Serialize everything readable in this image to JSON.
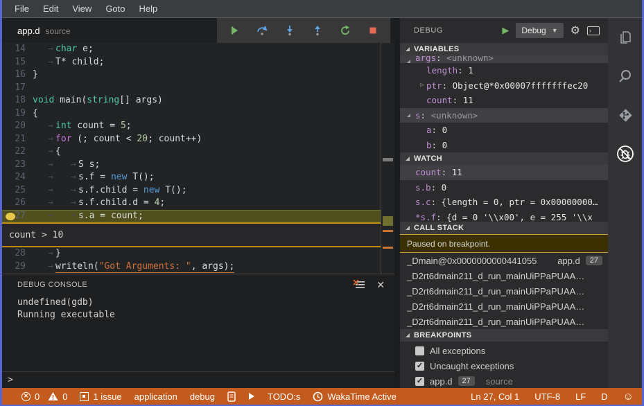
{
  "menu": {
    "items": [
      "File",
      "Edit",
      "View",
      "Goto",
      "Help"
    ]
  },
  "tab": {
    "name": "app.d",
    "hint": "source"
  },
  "debug_toolbar": {
    "buttons": [
      "continue",
      "step-over",
      "step-into",
      "step-out",
      "restart",
      "stop"
    ]
  },
  "editor": {
    "current_line": 27,
    "breakpoint_line": 27,
    "peek_after": 27,
    "peek_text": "count > 10",
    "lines": [
      {
        "n": 14,
        "tabs": 1,
        "tokens": [
          [
            "t",
            "char"
          ],
          [
            "p",
            " e;"
          ]
        ]
      },
      {
        "n": 15,
        "tabs": 1,
        "tokens": [
          [
            "p",
            "T* child;"
          ]
        ]
      },
      {
        "n": 16,
        "tabs": 0,
        "tokens": [
          [
            "p",
            "}"
          ]
        ]
      },
      {
        "n": 17,
        "tabs": 0,
        "tokens": []
      },
      {
        "n": 18,
        "tabs": 0,
        "tokens": [
          [
            "t",
            "void"
          ],
          [
            "p",
            " main("
          ],
          [
            "t",
            "string"
          ],
          [
            "p",
            "[] args)"
          ]
        ]
      },
      {
        "n": 19,
        "tabs": 0,
        "tokens": [
          [
            "p",
            "{"
          ]
        ]
      },
      {
        "n": 20,
        "tabs": 1,
        "tokens": [
          [
            "t",
            "int"
          ],
          [
            "p",
            " count = "
          ],
          [
            "n",
            "5"
          ],
          [
            "p",
            ";"
          ]
        ]
      },
      {
        "n": 21,
        "tabs": 1,
        "tokens": [
          [
            "k",
            "for"
          ],
          [
            "p",
            " (; count < "
          ],
          [
            "n",
            "20"
          ],
          [
            "p",
            "; count++)"
          ]
        ]
      },
      {
        "n": 22,
        "tabs": 1,
        "tokens": [
          [
            "p",
            "{"
          ]
        ]
      },
      {
        "n": 23,
        "tabs": 2,
        "tokens": [
          [
            "p",
            "S s;"
          ]
        ]
      },
      {
        "n": 24,
        "tabs": 2,
        "tokens": [
          [
            "p",
            "s.f = "
          ],
          [
            "b",
            "new"
          ],
          [
            "p",
            " T();"
          ]
        ]
      },
      {
        "n": 25,
        "tabs": 2,
        "tokens": [
          [
            "p",
            "s.f.child = "
          ],
          [
            "b",
            "new"
          ],
          [
            "p",
            " T();"
          ]
        ]
      },
      {
        "n": 26,
        "tabs": 2,
        "tokens": [
          [
            "p",
            "s.f.child.d = "
          ],
          [
            "n",
            "4"
          ],
          [
            "p",
            ";"
          ]
        ]
      },
      {
        "n": 27,
        "tabs": 2,
        "tokens": [
          [
            "p",
            "s.a = count;"
          ]
        ]
      },
      {
        "n": 28,
        "tabs": 1,
        "tokens": [
          [
            "p",
            "}"
          ]
        ]
      },
      {
        "n": 29,
        "tabs": 1,
        "u": true,
        "tokens": [
          [
            "p",
            "writeln("
          ],
          [
            "s",
            "\"Got Arguments: \""
          ],
          [
            "p",
            ", args);"
          ]
        ]
      }
    ]
  },
  "console": {
    "title": "DEBUG CONSOLE",
    "lines": [
      "undefined(gdb)",
      "Running executable"
    ],
    "prompt": ">"
  },
  "side_panel": {
    "title": "DEBUG",
    "config": "Debug",
    "variables": {
      "title": "VARIABLES",
      "rows": [
        {
          "indent": 1,
          "exp": "down",
          "name": "args",
          "value": "<unknown>",
          "sel": true,
          "clip": "top"
        },
        {
          "indent": 2,
          "name": "length",
          "value": "1"
        },
        {
          "indent": 2,
          "exp": "right",
          "name": "ptr",
          "value": "Object@*0x00007fffffffec20"
        },
        {
          "indent": 2,
          "name": "count",
          "value": "11"
        },
        {
          "indent": 1,
          "exp": "down",
          "name": "s",
          "value": "<unknown>",
          "sel": true
        },
        {
          "indent": 2,
          "name": "a",
          "value": "0"
        },
        {
          "indent": 2,
          "name": "b",
          "value": "0"
        }
      ]
    },
    "watch": {
      "title": "WATCH",
      "rows": [
        {
          "indent": 1,
          "name": "count",
          "value": "11",
          "sel": true
        },
        {
          "indent": 1,
          "name": "s.b",
          "value": "0"
        },
        {
          "indent": 1,
          "name": "s.c",
          "value": "{length = 0, ptr = 0x00000000…"
        },
        {
          "indent": 1,
          "name": "*s.f",
          "value": "{d = 0 '\\\\x00', e = 255 '\\\\x",
          "clip": "bottom"
        }
      ]
    },
    "call_stack": {
      "title": "CALL STACK",
      "status": "Paused on breakpoint.",
      "frames": [
        {
          "label": "_Dmain@0x0000000000441055",
          "file": "app.d",
          "line": "27"
        },
        {
          "label": "_D2rt6dmain211_d_run_mainUiPPaPUAA…"
        },
        {
          "label": "_D2rt6dmain211_d_run_mainUiPPaPUAA…"
        },
        {
          "label": "_D2rt6dmain211_d_run_mainUiPPaPUAA…"
        },
        {
          "label": "_D2rt6dmain211_d_run_mainUiPPaPUAA…"
        }
      ]
    },
    "breakpoints": {
      "title": "BREAKPOINTS",
      "items": [
        {
          "label": "All exceptions",
          "checked": false
        },
        {
          "label": "Uncaught exceptions",
          "checked": true
        },
        {
          "label": "app.d",
          "checked": true,
          "badge": "27",
          "hint": "source"
        }
      ]
    }
  },
  "activity_bar": {
    "icons": [
      "files",
      "search",
      "source-control",
      "debug"
    ]
  },
  "status_bar": {
    "errors": "0",
    "warnings": "0",
    "issues": "1 issue",
    "application": "application",
    "debug": "debug",
    "todos": "TODO:s",
    "wakatime": "WakaTime Active",
    "position": "Ln 27, Col 1",
    "encoding": "UTF-8",
    "eol": "LF",
    "language": "D"
  },
  "colors": {
    "status_bar": "#c25b1d",
    "window_border": "#5565d2",
    "current_line": "#50501e",
    "breakpoint_dot": "#e8c84a",
    "peek_border": "#c08a00"
  }
}
